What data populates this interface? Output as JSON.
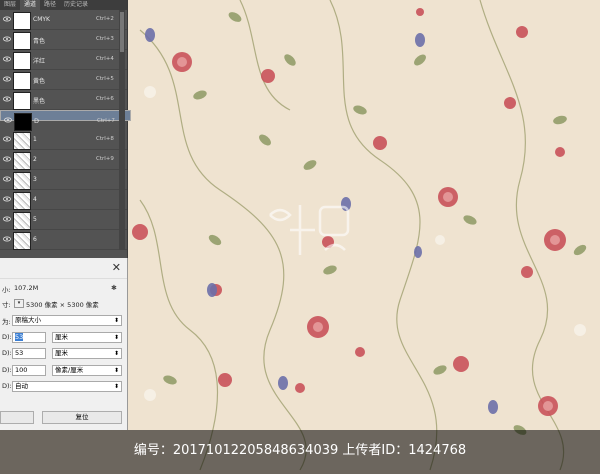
{
  "channels_panel": {
    "tabs": [
      "图层",
      "通道",
      "路径",
      "历史记录"
    ],
    "active_tab": "通道",
    "rows": [
      {
        "name": "CMYK",
        "shortcut": "Ctrl+2",
        "thumb": "white"
      },
      {
        "name": "青色",
        "shortcut": "Ctrl+3",
        "thumb": "white"
      },
      {
        "name": "洋红",
        "shortcut": "Ctrl+4",
        "thumb": "white"
      },
      {
        "name": "黄色",
        "shortcut": "Ctrl+5",
        "thumb": "white"
      },
      {
        "name": "黑色",
        "shortcut": "Ctrl+6",
        "thumb": "white"
      },
      {
        "name": "D",
        "shortcut": "Ctrl+7",
        "thumb": "black",
        "selected": true
      },
      {
        "name": "1",
        "shortcut": "Ctrl+8",
        "thumb": "texture"
      },
      {
        "name": "2",
        "shortcut": "Ctrl+9",
        "thumb": "texture"
      },
      {
        "name": "3",
        "shortcut": "",
        "thumb": "texture"
      },
      {
        "name": "4",
        "shortcut": "",
        "thumb": "texture"
      },
      {
        "name": "5",
        "shortcut": "",
        "thumb": "texture"
      },
      {
        "name": "6",
        "shortcut": "",
        "thumb": "texture"
      }
    ]
  },
  "image_size_dialog": {
    "size_label": "小:",
    "size_value": "107.2M",
    "dims_label": "寸:",
    "dims_value": "5300 像素 × 5300 像素",
    "fit_label": "为:",
    "fit_value": "原稿大小",
    "width_label": "D):",
    "width_value": "53",
    "width_unit": "厘米",
    "height_label": "D):",
    "height_value": "53",
    "height_unit": "厘米",
    "res_label": "D):",
    "res_value": "100",
    "res_unit": "像素/厘米",
    "resample_label": "D):",
    "resample_value": "自动",
    "reset_button": "复位"
  },
  "watermark": {
    "text": "编号：20171012205848634039 上传者ID：1424768"
  },
  "colors": {
    "background": "#efe3d0",
    "rose": "#c9525a",
    "bud_blue": "#6c6fa8",
    "leaf": "#7a8a5a",
    "panel": "#535353",
    "selected_row": "#6d7f97"
  }
}
